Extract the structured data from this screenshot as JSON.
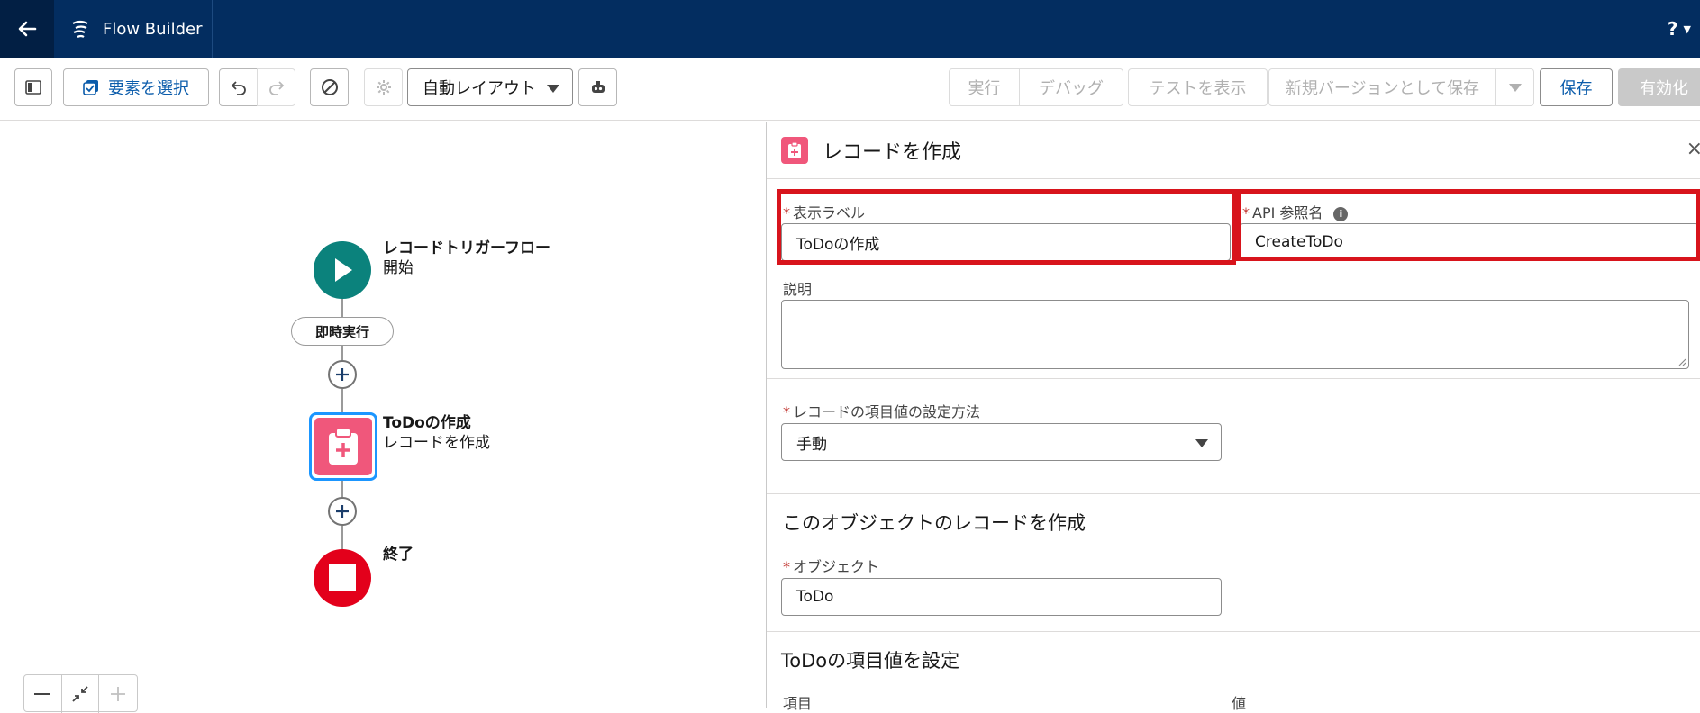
{
  "app": {
    "title": "Flow Builder",
    "help_label": "?"
  },
  "toolbar": {
    "select_elements": "要素を選択",
    "layout_select": "自動レイアウト",
    "run": "実行",
    "debug": "デバッグ",
    "view_tests": "テストを表示",
    "save_as_new_version": "新規バージョンとして保存",
    "save": "保存",
    "activate": "有効化"
  },
  "canvas": {
    "start_node": {
      "title": "レコードトリガーフロー",
      "subtitle": "開始"
    },
    "run_pill": "即時実行",
    "create_node": {
      "title": "ToDoの作成",
      "subtitle": "レコードを作成"
    },
    "end_node": {
      "title": "終了"
    }
  },
  "panel": {
    "title": "レコードを作成",
    "close_label": "×",
    "label_field": {
      "label": "表示ラベル",
      "required": "*",
      "value": "ToDoの作成"
    },
    "api_field": {
      "label": "API 参照名",
      "required": "*",
      "value": "CreateToDo",
      "info": "i"
    },
    "description_field": {
      "label": "説明",
      "value": ""
    },
    "set_method_field": {
      "label": "レコードの項目値の設定方法",
      "required": "*",
      "value": "手動"
    },
    "object_section": {
      "title": "このオブジェクトのレコードを作成",
      "object_field": {
        "label": "オブジェクト",
        "required": "*",
        "value": "ToDo"
      }
    },
    "values_section": {
      "title": "ToDoの項目値を設定",
      "col_field": "項目",
      "col_value": "値"
    }
  },
  "colors": {
    "header": "#032d60",
    "accent": "#0b5cab",
    "highlight": "#d8141c",
    "start": "#0b827c",
    "create": "#f0577b",
    "end": "#e3001b"
  }
}
